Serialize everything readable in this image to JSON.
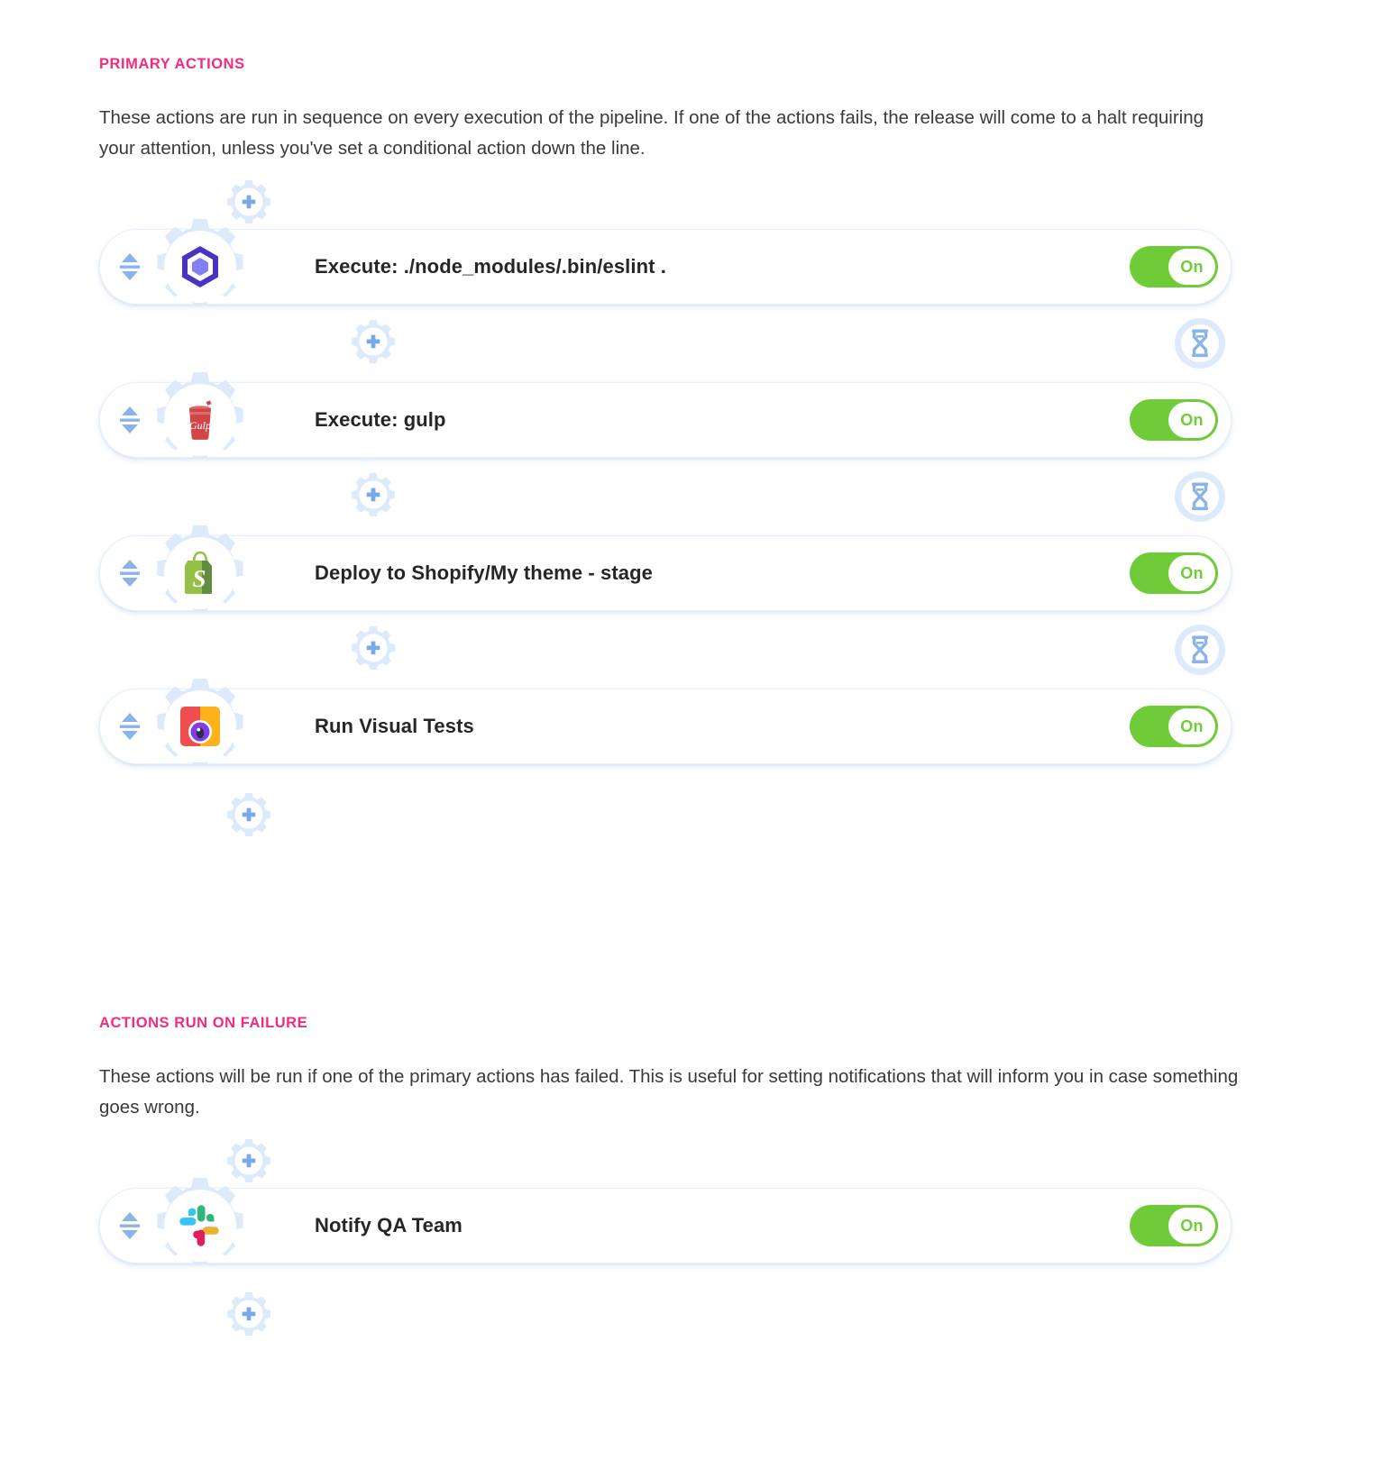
{
  "sections": [
    {
      "id": "primary",
      "title": "PRIMARY ACTIONS",
      "description": "These actions are run in sequence on every execution of the pipeline. If one of the actions fails, the release will come to a halt requiring your attention, unless you've set a conditional action down the line.",
      "actions": [
        {
          "label": "Execute: ./node_modules/.bin/eslint .",
          "icon": "eslint-icon",
          "toggle_label": "On",
          "toggle_state": "on"
        },
        {
          "label": "Execute: gulp",
          "icon": "gulp-icon",
          "toggle_label": "On",
          "toggle_state": "on"
        },
        {
          "label": "Deploy to Shopify/My theme - stage",
          "icon": "shopify-icon",
          "toggle_label": "On",
          "toggle_state": "on"
        },
        {
          "label": "Run Visual Tests",
          "icon": "applitools-icon",
          "toggle_label": "On",
          "toggle_state": "on"
        }
      ]
    },
    {
      "id": "failure",
      "title": "ACTIONS RUN ON FAILURE",
      "description": "These actions will be run if one of the primary actions has failed. This is useful for setting notifications that will inform you in case something goes wrong.",
      "actions": [
        {
          "label": "Notify QA Team",
          "icon": "slack-icon",
          "toggle_label": "On",
          "toggle_state": "on"
        }
      ]
    }
  ],
  "colors": {
    "heading_pink": "#f32b7f",
    "toggle_green": "#6fcc38",
    "body_text": "#3a3a3a",
    "action_text": "#262626",
    "node_blue": "#d7e7fb",
    "accent_blue": "#8ab4e8"
  },
  "icons": {
    "add_action": "plus-icon",
    "drag_handle": "reorder-icon",
    "conditional": "hourglass-icon"
  }
}
